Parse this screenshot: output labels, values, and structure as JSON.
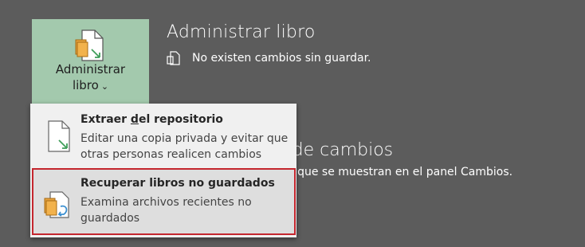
{
  "manage": {
    "label_line1": "Administrar",
    "label_line2": "libro",
    "chevron": "⌄"
  },
  "heading": "Administrar libro",
  "status": {
    "text": "No existen cambios sin guardar."
  },
  "background": {
    "partial_heading": "el de cambios",
    "partial_text": "bios que se muestran en el panel Cambios."
  },
  "menu": {
    "extract": {
      "title_before": "Extraer ",
      "title_underlined": "d",
      "title_after": "el repositorio",
      "description": "Editar una copia privada y evitar que otras personas realicen cambios"
    },
    "recover": {
      "title": "Recuperar libros no guardados",
      "description": "Examina archivos recientes no guardados"
    }
  },
  "colors": {
    "background": "#5c5c5c",
    "manage_button": "#a3c9ad",
    "menu": "#f0f0f0",
    "highlight_border": "#c4262e",
    "icon_orange": "#e8a33d",
    "icon_green": "#3f9e5a",
    "icon_blue": "#3a8fd0"
  },
  "icons": {
    "manage": "workbook-manage-icon",
    "status": "no-changes-icon",
    "extract": "document-extract-icon",
    "recover": "recover-workbook-icon"
  }
}
